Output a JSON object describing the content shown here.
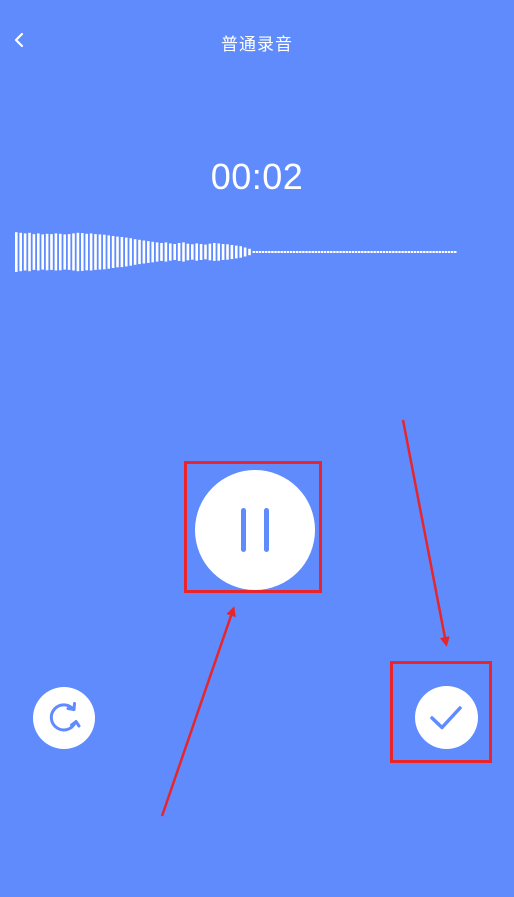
{
  "header": {
    "title": "普通录音",
    "back_icon": "chevron-left-icon"
  },
  "recording": {
    "elapsed_time": "00:02",
    "state": "recording"
  },
  "controls": {
    "pause_icon": "pause-icon",
    "reset_icon": "refresh-icon",
    "done_icon": "checkmark-icon"
  },
  "colors": {
    "background": "#5f8bfd",
    "button_fill": "#ffffff",
    "icon_color": "#5f8bfd",
    "annotation_red": "#e8252b"
  },
  "waveform": {
    "recorded_levels": [
      0.62,
      0.6,
      0.58,
      0.6,
      0.56,
      0.58,
      0.55,
      0.57,
      0.56,
      0.58,
      0.57,
      0.55,
      0.56,
      0.58,
      0.6,
      0.59,
      0.57,
      0.58,
      0.56,
      0.55,
      0.54,
      0.52,
      0.5,
      0.48,
      0.47,
      0.45,
      0.43,
      0.4,
      0.38,
      0.36,
      0.34,
      0.32,
      0.3,
      0.28,
      0.3,
      0.27,
      0.25,
      0.28,
      0.3,
      0.26,
      0.24,
      0.27,
      0.25,
      0.23,
      0.26,
      0.28,
      0.27,
      0.25,
      0.24,
      0.22,
      0.2,
      0.18,
      0.14,
      0.1
    ],
    "silence_segments": 66
  }
}
